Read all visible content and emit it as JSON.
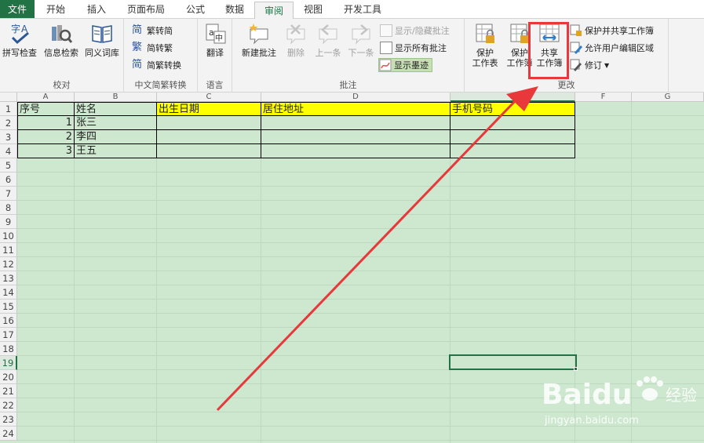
{
  "tabs": [
    {
      "label": "文件"
    },
    {
      "label": "开始"
    },
    {
      "label": "插入"
    },
    {
      "label": "页面布局"
    },
    {
      "label": "公式"
    },
    {
      "label": "数据"
    },
    {
      "label": "审阅"
    },
    {
      "label": "视图"
    },
    {
      "label": "开发工具"
    }
  ],
  "ribbon": {
    "proofing": {
      "spell": "拼写检查",
      "research": "信息检索",
      "thesaurus": "同义词库",
      "label": "校对"
    },
    "chinese": {
      "to_trad": "繁转简",
      "to_simp": "简转繁",
      "convert": "简繁转换",
      "label": "中文简繁转换"
    },
    "language": {
      "translate": "翻译",
      "label": "语言"
    },
    "comments": {
      "new": "新建批注",
      "delete": "删除",
      "prev": "上一条",
      "next": "下一条",
      "show_hide": "显示/隐藏批注",
      "show_all": "显示所有批注",
      "show_ink": "显示墨迹",
      "label": "批注"
    },
    "changes": {
      "protect_sheet_1": "保护",
      "protect_sheet_2": "工作表",
      "protect_wb_1": "保护",
      "protect_wb_2": "工作簿",
      "share_1": "共享",
      "share_2": "工作簿",
      "protect_share": "保护并共享工作簿",
      "allow_edit": "允许用户编辑区域",
      "track": "修订",
      "label": "更改"
    }
  },
  "sheet": {
    "columns": [
      "A",
      "B",
      "C",
      "D",
      "E",
      "F",
      "G"
    ],
    "rows": [
      "1",
      "2",
      "3",
      "4",
      "5",
      "6",
      "7",
      "8",
      "9",
      "10",
      "11",
      "12",
      "13",
      "14",
      "15",
      "16",
      "17",
      "18",
      "19",
      "20",
      "21",
      "22",
      "23",
      "24"
    ],
    "headers": [
      "序号",
      "姓名",
      "出生日期",
      "居住地址",
      "手机号码"
    ],
    "data": [
      {
        "num": "1",
        "name": "张三"
      },
      {
        "num": "2",
        "name": "李四"
      },
      {
        "num": "3",
        "name": "王五"
      }
    ],
    "selected_col": "E",
    "selected_row": "19"
  },
  "watermark": {
    "brand": "Baidu",
    "brand_cn": "经验",
    "url": "jingyan.baidu.com"
  }
}
